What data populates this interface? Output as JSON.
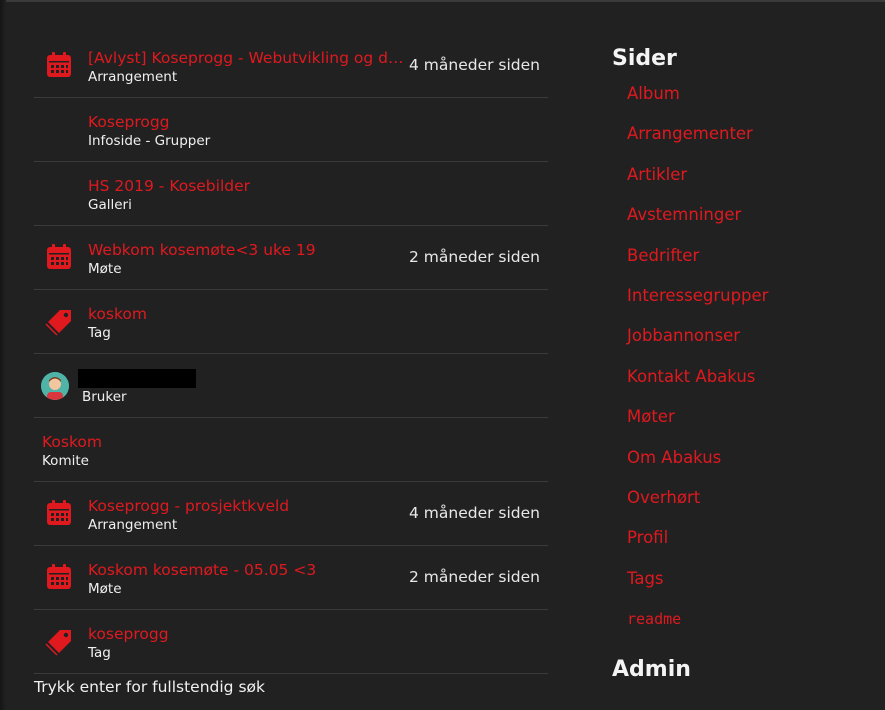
{
  "results": [
    {
      "icon": "calendar-icon",
      "title": "[Avlyst] Koseprogg - Webutvikling og då...",
      "sub": "Arrangement",
      "time": "4 måneder siden"
    },
    {
      "icon": "",
      "title": "Koseprogg",
      "sub": "Infoside - Grupper",
      "time": ""
    },
    {
      "icon": "",
      "title": "HS 2019 - Kosebilder",
      "sub": "Galleri",
      "time": ""
    },
    {
      "icon": "calendar-icon",
      "title": "Webkom kosemøte<3 uke 19",
      "sub": "Møte",
      "time": "2 måneder siden"
    },
    {
      "icon": "tag-icon",
      "title": "koskom",
      "sub": "Tag",
      "time": ""
    },
    {
      "icon": "avatar",
      "title": "",
      "sub": "Bruker",
      "time": ""
    },
    {
      "icon": "none",
      "title": "Koskom",
      "sub": "Komite",
      "time": ""
    },
    {
      "icon": "calendar-icon",
      "title": "Koseprogg - prosjektkveld",
      "sub": "Arrangement",
      "time": "4 måneder siden"
    },
    {
      "icon": "calendar-icon",
      "title": "Koskom kosemøte - 05.05 <3",
      "sub": "Møte",
      "time": "2 måneder siden"
    },
    {
      "icon": "tag-icon",
      "title": "koseprogg",
      "sub": "Tag",
      "time": ""
    }
  ],
  "hint": "Trykk enter for fullstendig søk",
  "sidebar": {
    "heading": "Sider",
    "links": [
      "Album",
      "Arrangementer",
      "Artikler",
      "Avstemninger",
      "Bedrifter",
      "Interessegrupper",
      "Jobbannonser",
      "Kontakt Abakus",
      "Møter",
      "Om Abakus",
      "Overhørt",
      "Profil",
      "Tags",
      "readme"
    ],
    "admin_heading": "Admin"
  },
  "colors": {
    "accent": "#e0191f",
    "background": "#212121"
  }
}
